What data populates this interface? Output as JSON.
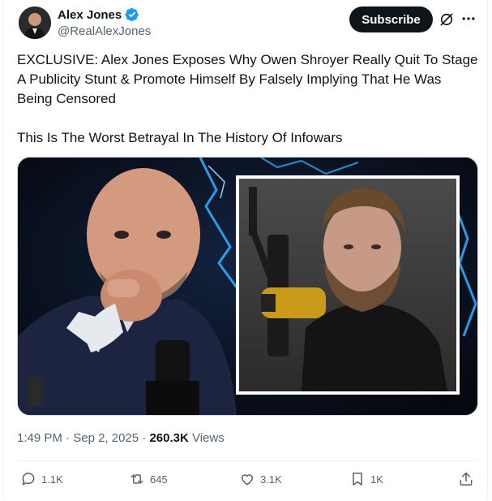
{
  "author": {
    "name": "Alex Jones",
    "handle": "@RealAlexJones",
    "verified_color": "#1d9bf0"
  },
  "header": {
    "subscribe_label": "Subscribe",
    "grok_icon": "grok-icon",
    "more_icon": "more-icon"
  },
  "post": {
    "paragraphs": [
      "EXCLUSIVE: Alex Jones Exposes Why Owen Shroyer Really Quit To Stage A Publicity Stunt & Promote Himself By Falsely Implying That He Was Being Censored",
      "This Is The Worst Betrayal In The History Of Infowars"
    ],
    "media_description_icon": "image"
  },
  "meta": {
    "time": "1:49 PM",
    "sep1": " · ",
    "date": "Sep 2, 2025",
    "sep2": " · ",
    "views_count": "260.3K",
    "views_label": " Views"
  },
  "actions": {
    "replies": "1.1K",
    "reposts": "645",
    "likes": "3.1K",
    "bookmarks": "1K",
    "repost_color": "#00ba7c"
  }
}
